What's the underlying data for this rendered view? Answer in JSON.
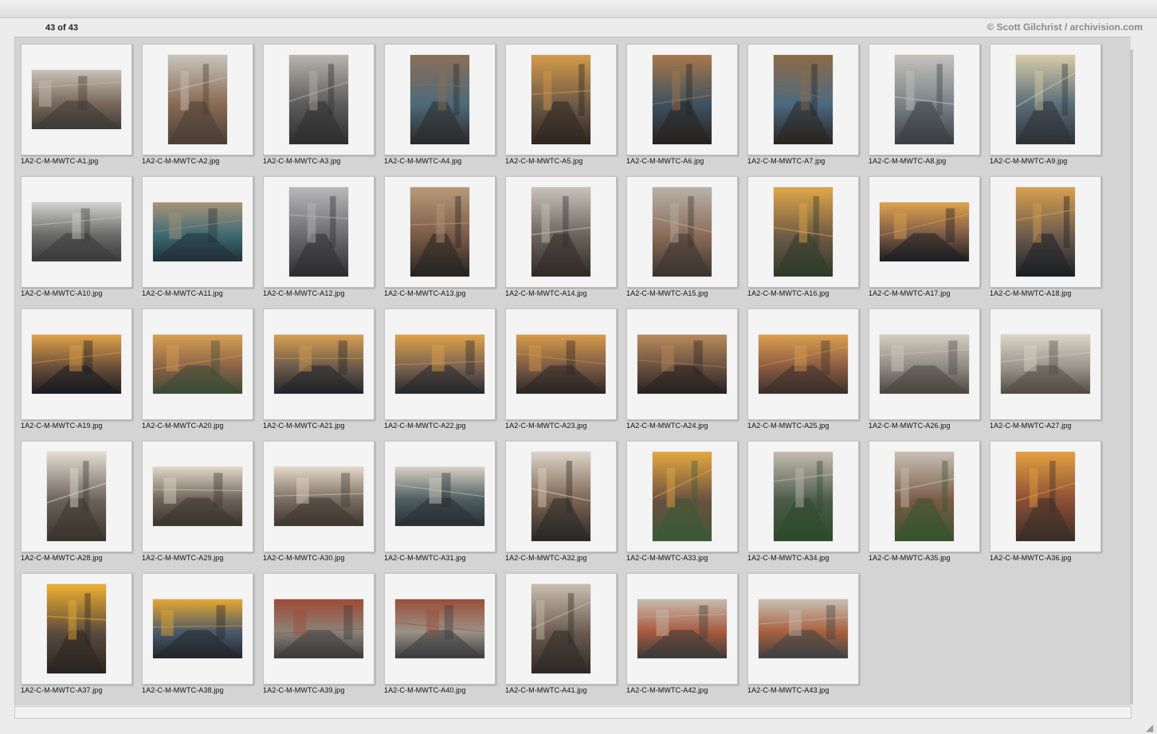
{
  "header": {
    "count_text": "43 of 43",
    "credit": "© Scott Gilchrist / archivision.com"
  },
  "thumbnails": [
    {
      "name": "1A2-C-M-MWTC-A1.jpg",
      "orientation": "landscape",
      "palette": [
        "#7a6a5c",
        "#c9c2b6",
        "#3e3a36"
      ]
    },
    {
      "name": "1A2-C-M-MWTC-A2.jpg",
      "orientation": "portrait",
      "palette": [
        "#8a6a52",
        "#c8c4bc",
        "#4a3e36"
      ]
    },
    {
      "name": "1A2-C-M-MWTC-A3.jpg",
      "orientation": "portrait",
      "palette": [
        "#5c5c5c",
        "#b8b4ae",
        "#2e2e2e"
      ]
    },
    {
      "name": "1A2-C-M-MWTC-A4.jpg",
      "orientation": "portrait",
      "palette": [
        "#4e6a7a",
        "#8a6e56",
        "#2a2a2a"
      ]
    },
    {
      "name": "1A2-C-M-MWTC-A5.jpg",
      "orientation": "portrait",
      "palette": [
        "#6e5a46",
        "#d49a4a",
        "#2e2620"
      ]
    },
    {
      "name": "1A2-C-M-MWTC-A6.jpg",
      "orientation": "portrait",
      "palette": [
        "#3e5262",
        "#a8784a",
        "#262220"
      ]
    },
    {
      "name": "1A2-C-M-MWTC-A7.jpg",
      "orientation": "portrait",
      "palette": [
        "#4a6a82",
        "#8e6a46",
        "#2a2420"
      ]
    },
    {
      "name": "1A2-C-M-MWTC-A8.jpg",
      "orientation": "portrait",
      "palette": [
        "#7a8288",
        "#c4c2bc",
        "#3a3e42"
      ]
    },
    {
      "name": "1A2-C-M-MWTC-A9.jpg",
      "orientation": "portrait",
      "palette": [
        "#5a6e7a",
        "#d8cca8",
        "#2e3236"
      ]
    },
    {
      "name": "1A2-C-M-MWTC-A10.jpg",
      "orientation": "landscape",
      "palette": [
        "#6a6a6a",
        "#d2d2d0",
        "#3a3a3a"
      ]
    },
    {
      "name": "1A2-C-M-MWTC-A11.jpg",
      "orientation": "landscape",
      "palette": [
        "#3e6a74",
        "#a89478",
        "#223038"
      ]
    },
    {
      "name": "1A2-C-M-MWTC-A12.jpg",
      "orientation": "portrait",
      "palette": [
        "#6a6a6e",
        "#b8b8b8",
        "#2e2e30"
      ]
    },
    {
      "name": "1A2-C-M-MWTC-A13.jpg",
      "orientation": "portrait",
      "palette": [
        "#7a5a46",
        "#b89a7a",
        "#262422"
      ]
    },
    {
      "name": "1A2-C-M-MWTC-A14.jpg",
      "orientation": "portrait",
      "palette": [
        "#6a625a",
        "#c8c4bc",
        "#302c28"
      ]
    },
    {
      "name": "1A2-C-M-MWTC-A15.jpg",
      "orientation": "portrait",
      "palette": [
        "#8a6a56",
        "#b8b2aa",
        "#3a3430"
      ]
    },
    {
      "name": "1A2-C-M-MWTC-A16.jpg",
      "orientation": "portrait",
      "palette": [
        "#6e5a46",
        "#e0a848",
        "#2e3a2a"
      ]
    },
    {
      "name": "1A2-C-M-MWTC-A17.jpg",
      "orientation": "landscape",
      "palette": [
        "#7a5a46",
        "#e0a24e",
        "#1e1e20"
      ]
    },
    {
      "name": "1A2-C-M-MWTC-A18.jpg",
      "orientation": "portrait",
      "palette": [
        "#6a5a4c",
        "#d8a050",
        "#1e2024"
      ]
    },
    {
      "name": "1A2-C-M-MWTC-A19.jpg",
      "orientation": "landscape",
      "palette": [
        "#6a4e3a",
        "#e0a248",
        "#1a1c20"
      ]
    },
    {
      "name": "1A2-C-M-MWTC-A20.jpg",
      "orientation": "landscape",
      "palette": [
        "#8a6248",
        "#d8a050",
        "#3a4a34"
      ]
    },
    {
      "name": "1A2-C-M-MWTC-A21.jpg",
      "orientation": "landscape",
      "palette": [
        "#6a5a4c",
        "#d8a050",
        "#222428"
      ]
    },
    {
      "name": "1A2-C-M-MWTC-A22.jpg",
      "orientation": "landscape",
      "palette": [
        "#7a6250",
        "#e0a24a",
        "#26282c"
      ]
    },
    {
      "name": "1A2-C-M-MWTC-A23.jpg",
      "orientation": "landscape",
      "palette": [
        "#7a5a46",
        "#d89a48",
        "#2a2624"
      ]
    },
    {
      "name": "1A2-C-M-MWTC-A24.jpg",
      "orientation": "landscape",
      "palette": [
        "#6a5040",
        "#b88a5a",
        "#262220"
      ]
    },
    {
      "name": "1A2-C-M-MWTC-A25.jpg",
      "orientation": "landscape",
      "palette": [
        "#8a5a42",
        "#dca04e",
        "#3a302a"
      ]
    },
    {
      "name": "1A2-C-M-MWTC-A26.jpg",
      "orientation": "landscape",
      "palette": [
        "#8e8a82",
        "#d4ccc0",
        "#4a4640"
      ]
    },
    {
      "name": "1A2-C-M-MWTC-A27.jpg",
      "orientation": "landscape",
      "palette": [
        "#9a948a",
        "#dcd4c8",
        "#524c44"
      ]
    },
    {
      "name": "1A2-C-M-MWTC-A28.jpg",
      "orientation": "portrait",
      "palette": [
        "#6a6258",
        "#e4ddd2",
        "#3a342e"
      ]
    },
    {
      "name": "1A2-C-M-MWTC-A29.jpg",
      "orientation": "landscape",
      "palette": [
        "#6e645a",
        "#e0d6c8",
        "#3a342e"
      ]
    },
    {
      "name": "1A2-C-M-MWTC-A30.jpg",
      "orientation": "landscape",
      "palette": [
        "#7a6e62",
        "#e4d8c8",
        "#3e3630"
      ]
    },
    {
      "name": "1A2-C-M-MWTC-A31.jpg",
      "orientation": "landscape",
      "palette": [
        "#4e5e62",
        "#d8d0c4",
        "#2a3032"
      ]
    },
    {
      "name": "1A2-C-M-MWTC-A32.jpg",
      "orientation": "portrait",
      "palette": [
        "#7a6250",
        "#dcd4c8",
        "#2a2826"
      ]
    },
    {
      "name": "1A2-C-M-MWTC-A33.jpg",
      "orientation": "portrait",
      "palette": [
        "#6a5040",
        "#e4a840",
        "#3a5a34"
      ]
    },
    {
      "name": "1A2-C-M-MWTC-A34.jpg",
      "orientation": "portrait",
      "palette": [
        "#4a5a4a",
        "#c4bcb0",
        "#2e4a2a"
      ]
    },
    {
      "name": "1A2-C-M-MWTC-A35.jpg",
      "orientation": "portrait",
      "palette": [
        "#7a5a46",
        "#c8c0b4",
        "#34542e"
      ]
    },
    {
      "name": "1A2-C-M-MWTC-A36.jpg",
      "orientation": "portrait",
      "palette": [
        "#8a4e36",
        "#e4a040",
        "#3a2e26"
      ]
    },
    {
      "name": "1A2-C-M-MWTC-A37.jpg",
      "orientation": "portrait",
      "palette": [
        "#5a4a3e",
        "#f0b030",
        "#2a2420"
      ]
    },
    {
      "name": "1A2-C-M-MWTC-A38.jpg",
      "orientation": "landscape",
      "palette": [
        "#4a5a6a",
        "#e8a830",
        "#22262a"
      ]
    },
    {
      "name": "1A2-C-M-MWTC-A39.jpg",
      "orientation": "landscape",
      "palette": [
        "#8a8278",
        "#a04a36",
        "#3a3a3a"
      ]
    },
    {
      "name": "1A2-C-M-MWTC-A40.jpg",
      "orientation": "landscape",
      "palette": [
        "#9a9286",
        "#9a4e3a",
        "#3a3c3e"
      ]
    },
    {
      "name": "1A2-C-M-MWTC-A41.jpg",
      "orientation": "portrait",
      "palette": [
        "#6a5a4e",
        "#c8beb0",
        "#2e2a26"
      ]
    },
    {
      "name": "1A2-C-M-MWTC-A42.jpg",
      "orientation": "landscape",
      "palette": [
        "#a85a3e",
        "#c8bcb0",
        "#3a3a3a"
      ]
    },
    {
      "name": "1A2-C-M-MWTC-A43.jpg",
      "orientation": "landscape",
      "palette": [
        "#a8603e",
        "#c8c0b4",
        "#3e4244"
      ]
    }
  ]
}
